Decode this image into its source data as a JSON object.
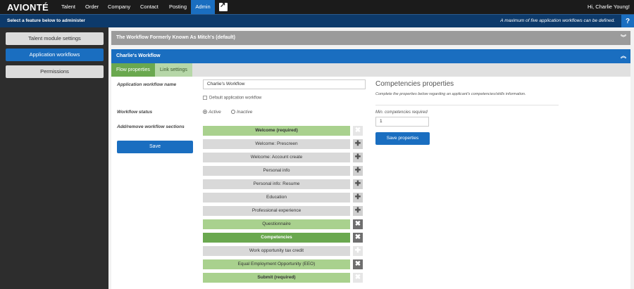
{
  "nav": {
    "logo": "AVIONTÉ",
    "items": [
      "Talent",
      "Order",
      "Company",
      "Contact",
      "Posting",
      "Admin"
    ],
    "active": "Admin",
    "greeting": "Hi, Charlie Young!"
  },
  "subbar": {
    "hint": "Select a feature below to administer",
    "limit": "A maximum of five application workflows can be defined.",
    "help": "?"
  },
  "sidebar": {
    "items": [
      {
        "label": "Talent module settings"
      },
      {
        "label": "Application workflows"
      },
      {
        "label": "Permissions"
      }
    ]
  },
  "workflows": {
    "collapsed_title": "The Workflow Formerly Known As Mitch's (default)",
    "expanded_title": "Charlie's Workflow"
  },
  "tabs": [
    "Flow properties",
    "Link settings"
  ],
  "form": {
    "name_label": "Application workflow name",
    "name_value": "Charlie's Workflow",
    "default_label": "Default application workflow",
    "status_label": "Workflow status",
    "status_active": "Active",
    "status_inactive": "Inactive",
    "sections_label": "Add/remove workflow sections",
    "save_label": "Save"
  },
  "sections": [
    {
      "label": "Welcome (required)",
      "state": "required",
      "action": "x-disabled"
    },
    {
      "label": "Welcome: Prescreen",
      "state": "off",
      "action": "plus"
    },
    {
      "label": "Welcome: Account create",
      "state": "off",
      "action": "plus"
    },
    {
      "label": "Personal info",
      "state": "off",
      "action": "plus"
    },
    {
      "label": "Personal info: Resume",
      "state": "off",
      "action": "plus"
    },
    {
      "label": "Education",
      "state": "off",
      "action": "plus"
    },
    {
      "label": "Professional experience",
      "state": "off",
      "action": "plus"
    },
    {
      "label": "Questionnaire",
      "state": "on",
      "action": "x"
    },
    {
      "label": "Competencies",
      "state": "selected",
      "action": "x"
    },
    {
      "label": "Work opportunity tax credit",
      "state": "off",
      "action": "plus-disabled"
    },
    {
      "label": "Equal Employment Opportunity (EEO)",
      "state": "on",
      "action": "x"
    },
    {
      "label": "Submit (required)",
      "state": "required",
      "action": "x-disabled"
    }
  ],
  "competencies": {
    "title": "Competencies properties",
    "description": "Complete the properties below regarding an applicant's competencies/skills information.",
    "min_label": "Min. competencies required",
    "min_value": "1",
    "save_label": "Save properties"
  }
}
